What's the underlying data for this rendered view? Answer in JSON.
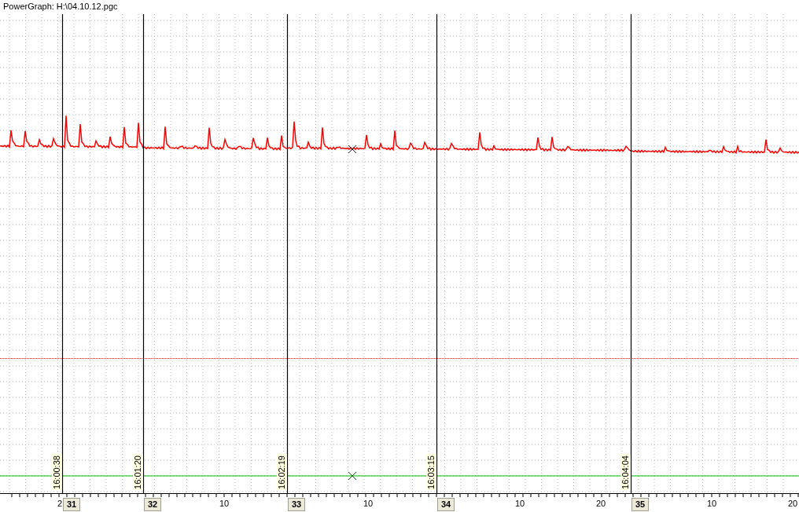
{
  "window": {
    "title": "PowerGraph: H:\\04.10.12.pgc"
  },
  "axis": {
    "leading_label": "2"
  },
  "markers": [
    {
      "time": "16:00:38",
      "number": "31"
    },
    {
      "time": "16:01:20",
      "number": "32",
      "tick_labels": [
        "10"
      ]
    },
    {
      "time": "16:02:19",
      "number": "33",
      "tick_labels": [
        "10"
      ]
    },
    {
      "time": "16:03:15",
      "number": "34",
      "tick_labels": [
        "10",
        "20"
      ]
    },
    {
      "time": "16:04:04",
      "number": "35",
      "tick_labels": [
        "10",
        "20"
      ]
    }
  ]
}
